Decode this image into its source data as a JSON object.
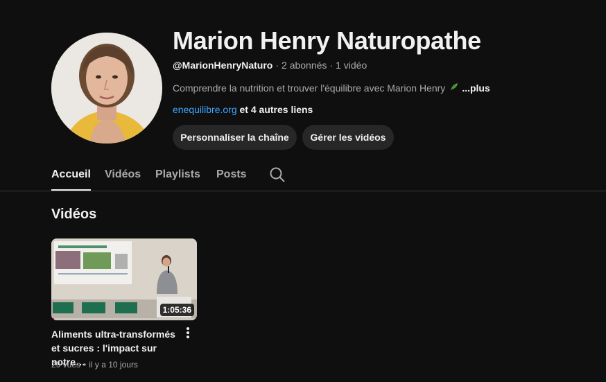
{
  "channel": {
    "name": "Marion Henry Naturopathe",
    "handle": "@MarionHenryNaturo",
    "subscribers": "2 abonnés",
    "video_count": "1 vidéo",
    "description": "Comprendre la nutrition et trouver l'équilibre avec Marion Henry",
    "description_icon": "leaf-icon",
    "more_label": "...plus",
    "link": "enequilibre.org",
    "other_links": "et 4 autres liens",
    "meta_separator": "·"
  },
  "buttons": {
    "customize": "Personnaliser la chaîne",
    "manage": "Gérer les vidéos"
  },
  "tabs": [
    {
      "label": "Accueil",
      "active": true
    },
    {
      "label": "Vidéos",
      "active": false
    },
    {
      "label": "Playlists",
      "active": false
    },
    {
      "label": "Posts",
      "active": false
    }
  ],
  "search_icon": "search-icon",
  "section": {
    "title": "Vidéos"
  },
  "video": {
    "title": "Aliments ultra-transformés et sucres : l'impact sur notre…",
    "duration": "1:05:36",
    "views": "29 vues",
    "age": "il y a 10 jours",
    "meta_separator": "•",
    "watch_progress": 0.02
  },
  "colors": {
    "background": "#0f0f0f",
    "link": "#3ea6ff",
    "button_bg": "#272727",
    "progress": "#ff0033"
  }
}
